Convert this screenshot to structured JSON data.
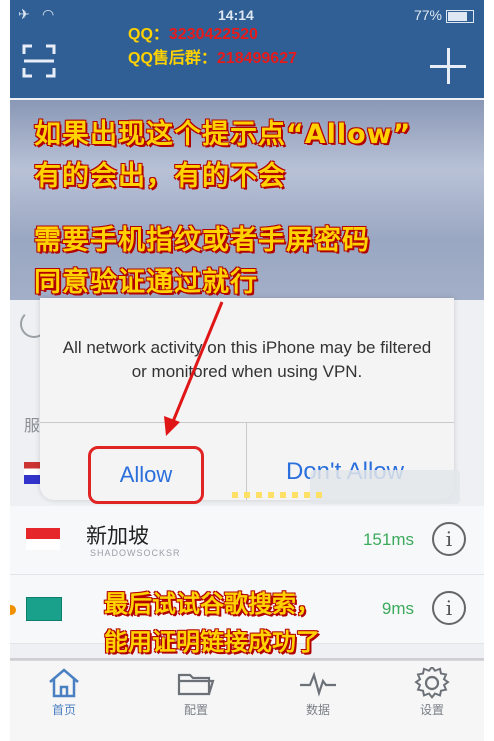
{
  "status": {
    "time": "14:14",
    "battery": "77%"
  },
  "contact": {
    "qq_label": "QQ：",
    "qq_value": "3230422520",
    "group_label": "QQ售后群：",
    "group_value": "218499627"
  },
  "instructions": {
    "line1": "如果出现这个提示点“Allow”",
    "line2": "有的会出，有的不会",
    "line3": "需要手机指纹或者手屏密码",
    "line4": "同意验证通过就行",
    "bottom1": "最后试试谷歌搜索，",
    "bottom2": "能用证明链接成功了"
  },
  "alert": {
    "message": "All network activity on this iPhone may be filtered or monitored when using VPN.",
    "allow_label": "Allow",
    "dont_allow_label": "Don't Allow"
  },
  "servers": [
    {
      "name": "新加坡",
      "protocol": "SHADOWSOCKSR",
      "latency": "151ms"
    },
    {
      "latency": "9ms"
    }
  ],
  "side_letter": "服",
  "tabs": [
    {
      "label": "首页"
    },
    {
      "label": "配置"
    },
    {
      "label": "数据"
    },
    {
      "label": "设置"
    }
  ],
  "colors": {
    "nav": "#2f5f95",
    "accent": "#ffd200",
    "alert_red": "#e02424",
    "link_blue": "#2a6fdb"
  }
}
